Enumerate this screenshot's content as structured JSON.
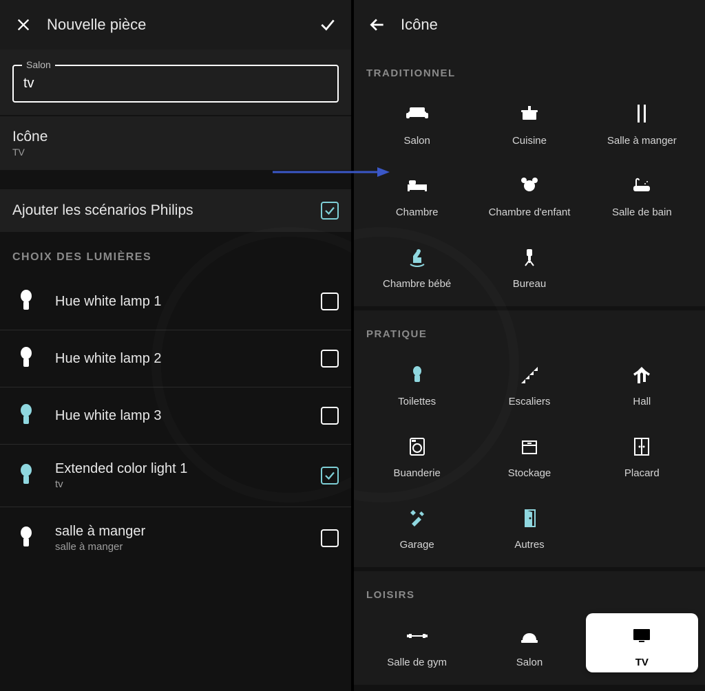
{
  "left": {
    "title": "Nouvelle pièce",
    "field_legend": "Salon",
    "field_value": "tv",
    "icon_row_label": "Icône",
    "icon_row_sub": "TV",
    "scenario_label": "Ajouter les scénarios Philips",
    "section_lights": "CHOIX DES LUMIÈRES",
    "lights": [
      {
        "name": "Hue white lamp 1",
        "sub": "",
        "checked": false,
        "color": "#ffffff"
      },
      {
        "name": "Hue white lamp 2",
        "sub": "",
        "checked": false,
        "color": "#ffffff"
      },
      {
        "name": "Hue white lamp 3",
        "sub": "",
        "checked": false,
        "color": "#8fd7df"
      },
      {
        "name": "Extended color light 1",
        "sub": "tv",
        "checked": true,
        "color": "#8fd7df"
      },
      {
        "name": "salle à manger",
        "sub": "salle à manger",
        "checked": false,
        "color": "#ffffff"
      }
    ]
  },
  "right": {
    "title": "Icône",
    "cat1": "TRADITIONNEL",
    "cat2": "PRATIQUE",
    "cat3": "LOISIRS",
    "traditionnel": [
      {
        "label": "Salon",
        "icon": "sofa"
      },
      {
        "label": "Cuisine",
        "icon": "pot"
      },
      {
        "label": "Salle à manger",
        "icon": "fork"
      },
      {
        "label": "Chambre",
        "icon": "bed"
      },
      {
        "label": "Chambre d'enfant",
        "icon": "teddy"
      },
      {
        "label": "Salle de bain",
        "icon": "bath"
      },
      {
        "label": "Chambre bébé",
        "icon": "rocking",
        "accent": true
      },
      {
        "label": "Bureau",
        "icon": "chair"
      }
    ],
    "pratique": [
      {
        "label": "Toilettes",
        "icon": "toilet",
        "accent": true
      },
      {
        "label": "Escaliers",
        "icon": "stairs"
      },
      {
        "label": "Hall",
        "icon": "coat"
      },
      {
        "label": "Buanderie",
        "icon": "washer"
      },
      {
        "label": "Stockage",
        "icon": "box"
      },
      {
        "label": "Placard",
        "icon": "closet"
      },
      {
        "label": "Garage",
        "icon": "tools",
        "accent": true
      },
      {
        "label": "Autres",
        "icon": "door",
        "accent": true
      }
    ],
    "loisirs": [
      {
        "label": "Salle de gym",
        "icon": "gym"
      },
      {
        "label": "Salon",
        "icon": "lounge"
      },
      {
        "label": "TV",
        "icon": "tv",
        "selected": true
      }
    ]
  }
}
